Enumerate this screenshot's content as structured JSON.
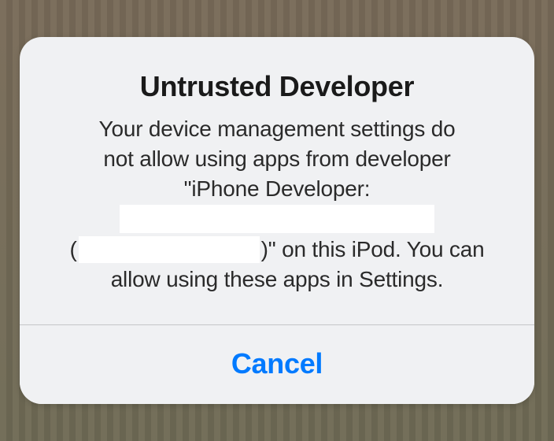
{
  "alert": {
    "title": "Untrusted Developer",
    "message_line1": "Your device management settings do",
    "message_line2": "not allow using apps from developer",
    "message_line3": "\"iPhone Developer:",
    "message_line4_prefix": "(",
    "message_line4_suffix": ")\" on this iPod. You can",
    "message_line5": "allow using these apps in Settings.",
    "cancel_label": "Cancel"
  }
}
